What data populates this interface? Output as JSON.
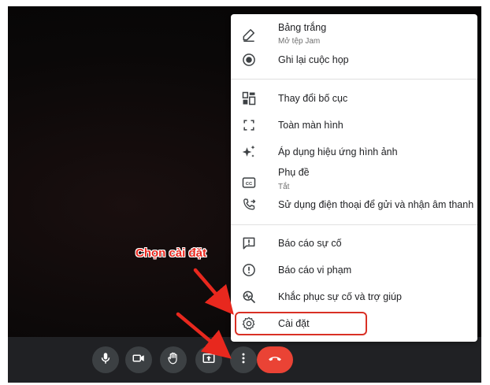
{
  "menu": {
    "items": [
      {
        "icon": "pen-icon",
        "label": "Bảng trắng",
        "sub": "Mở tệp Jam"
      },
      {
        "icon": "record-icon",
        "label": "Ghi lại cuộc họp"
      },
      {
        "icon": "layout-icon",
        "label": "Thay đổi bố cục"
      },
      {
        "icon": "fullscreen-icon",
        "label": "Toàn màn hình"
      },
      {
        "icon": "sparkle-icon",
        "label": "Áp dụng hiệu ứng hình ảnh"
      },
      {
        "icon": "captions-icon",
        "label": "Phụ đề",
        "sub": "Tắt"
      },
      {
        "icon": "phone-forward-icon",
        "label": "Sử dụng điện thoại để gửi và nhận âm thanh"
      },
      {
        "icon": "report-problem-icon",
        "label": "Báo cáo sự cố"
      },
      {
        "icon": "report-abuse-icon",
        "label": "Báo cáo vi phạm"
      },
      {
        "icon": "troubleshoot-icon",
        "label": "Khắc phục sự cố và trợ giúp"
      },
      {
        "icon": "gear-icon",
        "label": "Cài đặt"
      }
    ]
  },
  "toolbar": {
    "buttons": [
      "mic-icon",
      "camera-icon",
      "raise-hand-icon",
      "present-icon",
      "more-options-icon",
      "end-call-icon"
    ]
  },
  "annotation": {
    "callout": "Chọn cài đặt",
    "color": "#e8281e"
  },
  "colors": {
    "end_call": "#ea4335",
    "toolbar_bg": "#202124",
    "button_bg": "#3c4043"
  }
}
